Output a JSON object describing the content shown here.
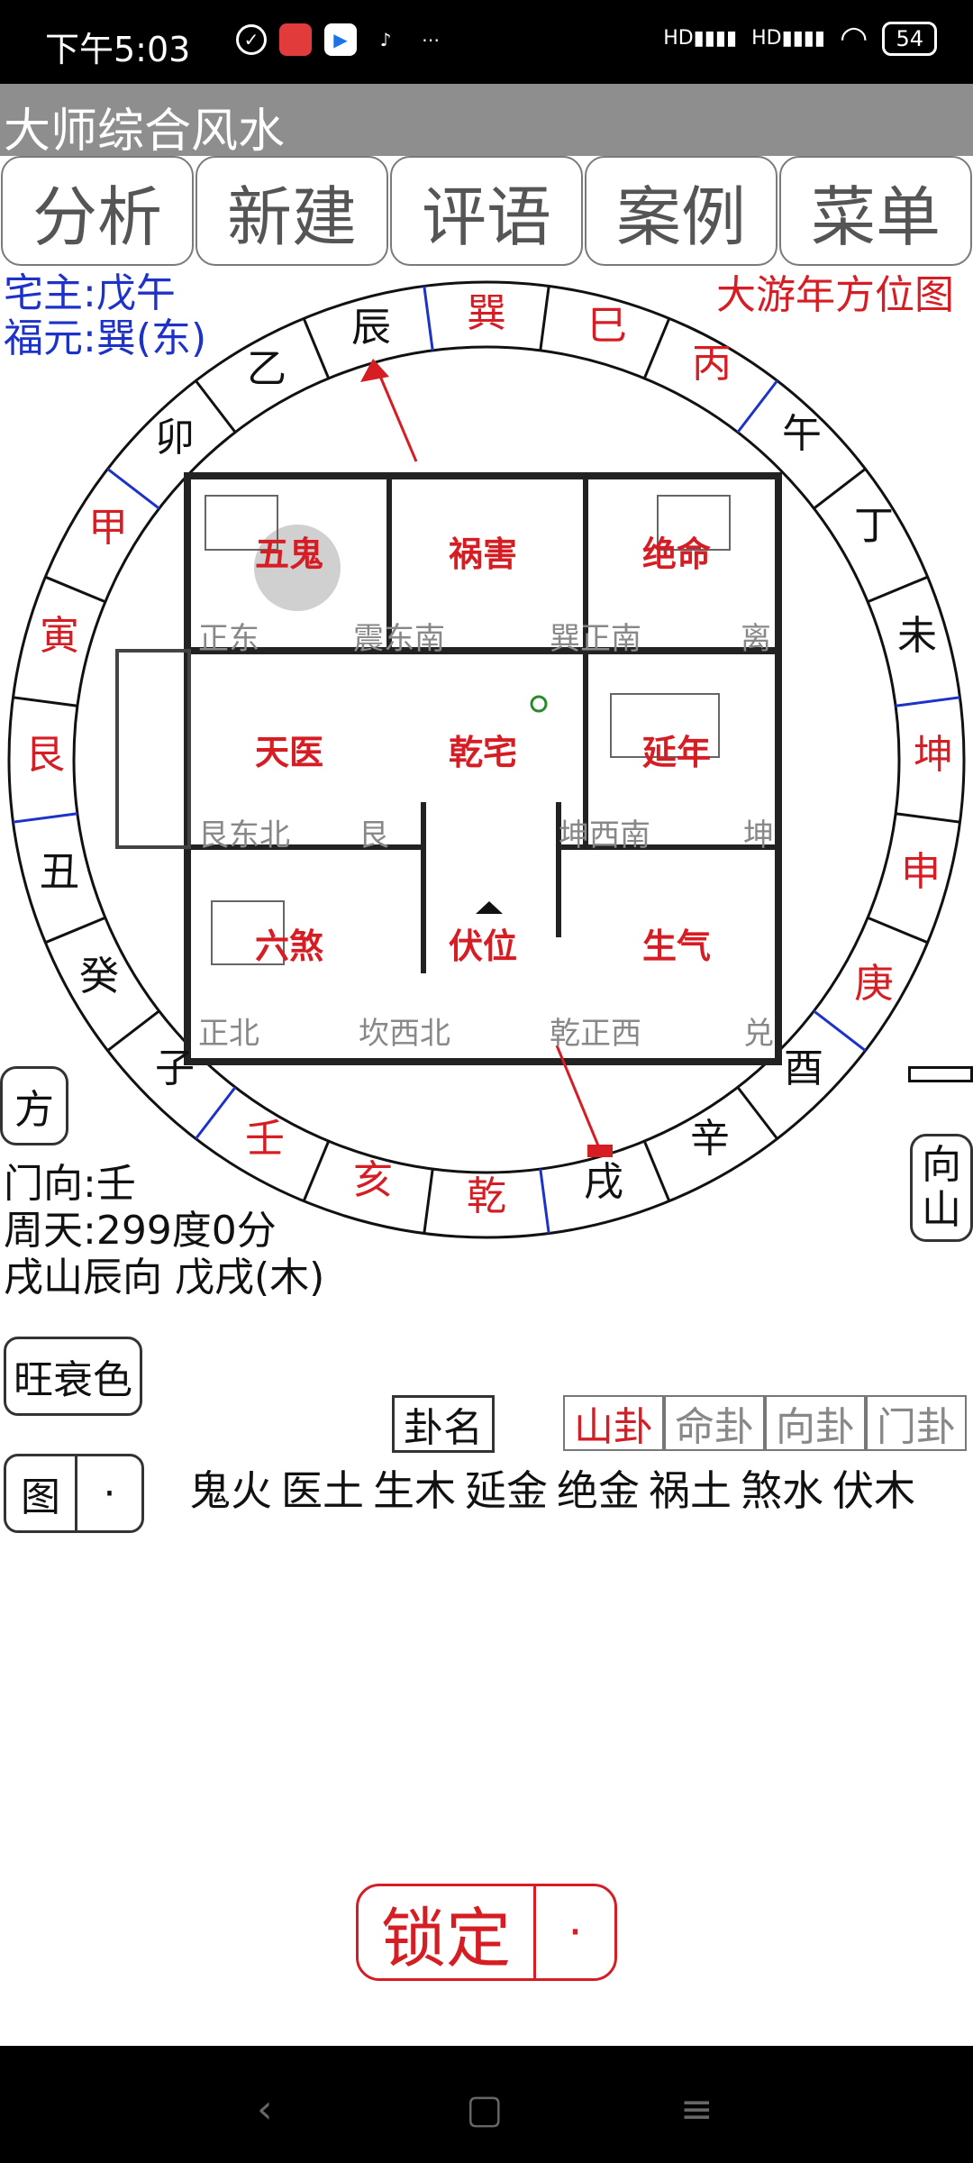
{
  "status_bar": {
    "time": "下午5:03",
    "battery": "54",
    "app_icons": [
      "alarm-icon",
      "app-red-icon",
      "play-store-icon",
      "tiktok-icon",
      "more-dots-icon"
    ]
  },
  "app": {
    "title": "大师综合风水"
  },
  "tabs": [
    {
      "label": "分析"
    },
    {
      "label": "新建"
    },
    {
      "label": "评语"
    },
    {
      "label": "案例"
    },
    {
      "label": "菜单"
    }
  ],
  "owner": {
    "zhaizhu": "宅主:戊午",
    "fuyuan": "福元:巽(东)"
  },
  "map_title": "大游年方位图",
  "ring_labels": {
    "chen": "辰",
    "xun": "巽",
    "si": "巳",
    "bing": "丙",
    "wu": "午",
    "ding": "丁",
    "wei": "未",
    "kun": "坤",
    "shen": "申",
    "geng": "庚",
    "you": "酉",
    "xin": "辛",
    "xu": "戌",
    "qian": "乾",
    "hai": "亥",
    "ren": "壬",
    "zi": "子",
    "gui": "癸",
    "chou": "丑",
    "gen": "艮",
    "yin": "寅",
    "jia": "甲",
    "mao": "卯",
    "yi": "乙"
  },
  "plan_labels": {
    "wugui": "五鬼",
    "huohai": "祸害",
    "jueming": "绝命",
    "tianyi": "天医",
    "qianzhai": "乾宅",
    "yannian": "延年",
    "liusha": "六煞",
    "fuwei": "伏位",
    "shengqi": "生气",
    "zhengdong": "正东",
    "zhendongnan": "震东南",
    "xundongnan": "巽正南",
    "li": "离",
    "gendongbei": "艮东北",
    "gen2": "艮",
    "kunxinan": "坤西南",
    "kun2": "坤",
    "zhengbei": "正北",
    "kanxibei": "坎西北",
    "qianzhengxi": "乾正西",
    "dui": "兑"
  },
  "side_buttons": {
    "fang": "方",
    "xiang": "向",
    "shan": "山"
  },
  "info_lines": {
    "menxiang": "门向:壬",
    "zhoutian": "周天:299度0分",
    "shanxiang": "戌山辰向 戊戌(木)"
  },
  "buttons": {
    "wangshuai": "旺衰色",
    "tu": "图",
    "tu_dot": "·",
    "guaming": "卦名",
    "lock": "锁定",
    "lock_dot": "·"
  },
  "gua_tabs": [
    {
      "label": "山卦",
      "active": true
    },
    {
      "label": "命卦",
      "active": false
    },
    {
      "label": "向卦",
      "active": false
    },
    {
      "label": "门卦",
      "active": false
    }
  ],
  "stars": [
    "鬼火",
    "医土",
    "生木",
    "延金",
    "绝金",
    "祸土",
    "煞水",
    "伏木"
  ],
  "colors": {
    "accent_red": "#d61d24",
    "blue": "#1d32c8",
    "appbar": "#8e8e8e"
  }
}
